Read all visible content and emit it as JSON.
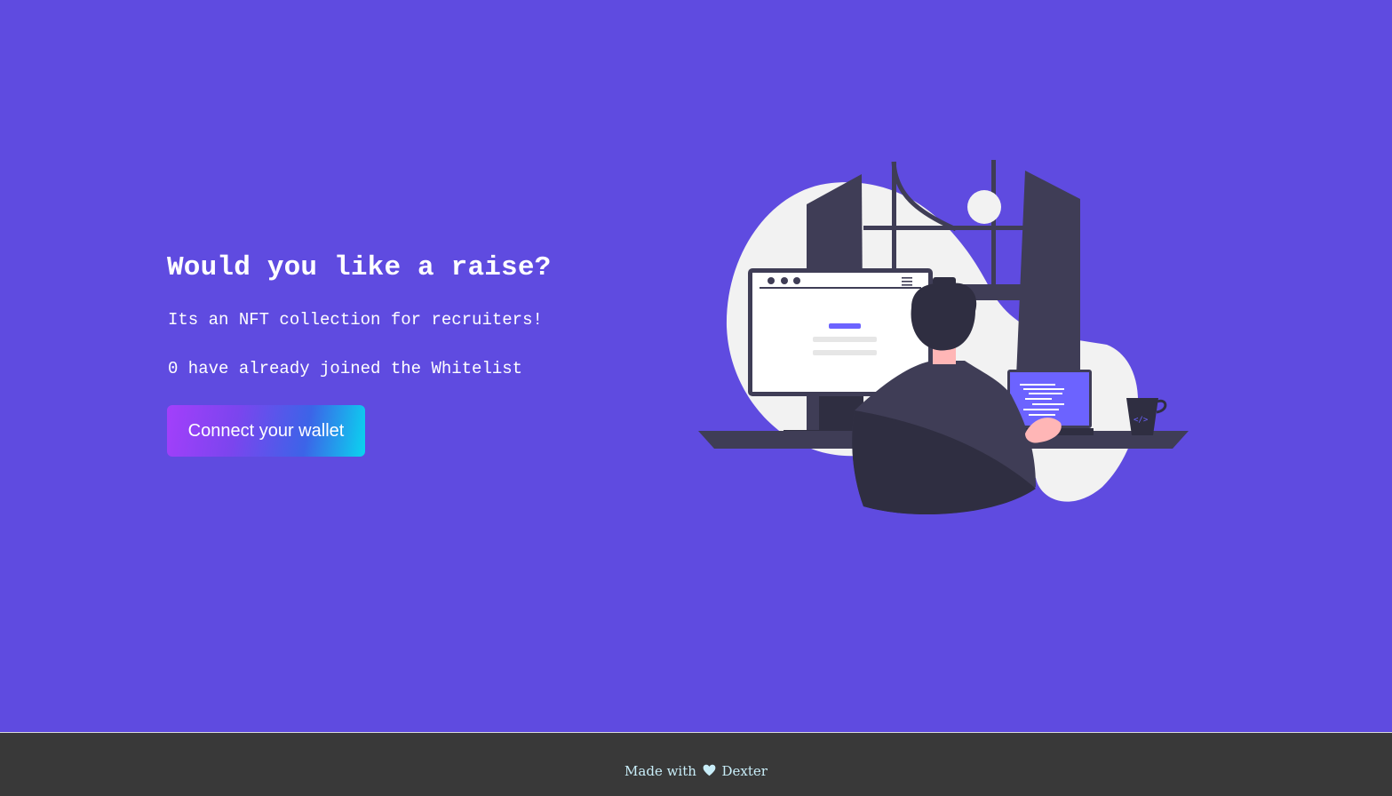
{
  "hero": {
    "title": "Would you like a raise?",
    "subtitle": "Its an NFT collection for recruiters!",
    "whitelist_count": "0",
    "whitelist_text": " have already joined the Whitelist",
    "connect_button": "Connect your wallet"
  },
  "illustration": {
    "name": "programmer-at-desk-illustration",
    "accent_color": "#6c63ff"
  },
  "footer": {
    "made_with": "Made with",
    "heart_icon": "heart-icon",
    "author": "Dexter"
  },
  "colors": {
    "background": "#5f4be0",
    "footer_background": "#393939",
    "footer_text": "#c9eef9"
  }
}
